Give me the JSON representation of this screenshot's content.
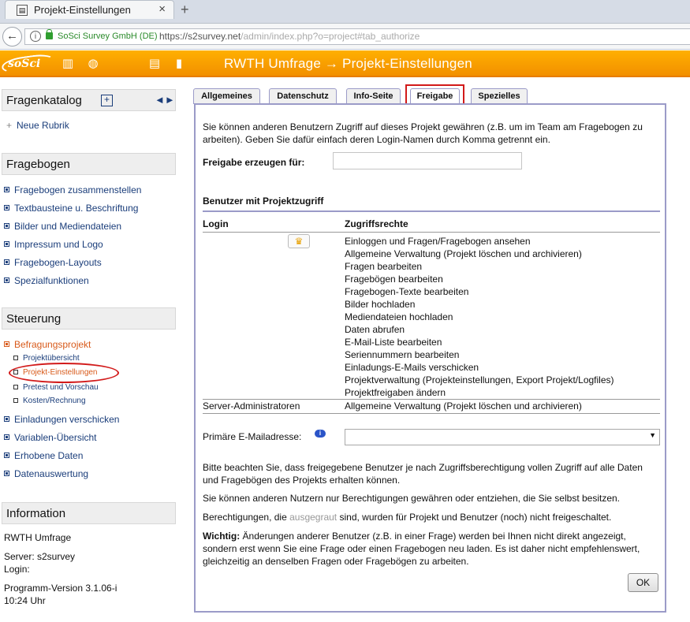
{
  "browser": {
    "tab_title": "Projekt-Einstellungen",
    "org": "SoSci Survey GmbH (DE)",
    "url_host": "https://s2survey.net",
    "url_path": "/admin/index.php?o=project#tab_authorize"
  },
  "header": {
    "logo": "soSci",
    "title": "RWTH Umfrage → Projekt-Einstellungen",
    "accent": "#f59a00"
  },
  "sidebar": {
    "fragenkatalog": {
      "title": "Fragenkatalog",
      "new_label": "Neue Rubrik"
    },
    "fragebogen": {
      "title": "Fragebogen",
      "items": [
        "Fragebogen zusammenstellen",
        "Textbausteine u. Beschriftung",
        "Bilder und Mediendateien",
        "Impressum und Logo",
        "Fragebogen-Layouts",
        "Spezialfunktionen"
      ]
    },
    "steuerung": {
      "title": "Steuerung",
      "active_item": "Befragungsprojekt",
      "subitems": [
        "Projektübersicht",
        "Projekt-Einstellungen",
        "Pretest und Vorschau",
        "Kosten/Rechnung"
      ],
      "items": [
        "Einladungen verschicken",
        "Variablen-Übersicht",
        "Erhobene Daten",
        "Datenauswertung"
      ]
    },
    "information": {
      "title": "Information",
      "project": "RWTH Umfrage",
      "server": "Server: s2survey",
      "login": "Login:",
      "version": "Programm-Version 3.1.06-i",
      "time": "10:24 Uhr"
    }
  },
  "tabs": [
    {
      "label": "Allgemeines",
      "selected": false
    },
    {
      "label": "Datenschutz",
      "selected": false
    },
    {
      "label": "Info-Seite",
      "selected": false
    },
    {
      "label": "Freigabe",
      "selected": true
    },
    {
      "label": "Spezielles",
      "selected": false
    }
  ],
  "panel": {
    "intro": "Sie können anderen Benutzern Zugriff auf dieses Projekt gewähren (z.B. um im Team am Fragebogen zu arbeiten). Geben Sie dafür einfach deren Login-Namen durch Komma getrennt ein.",
    "share_label": "Freigabe erzeugen für:",
    "share_value": "",
    "users_heading": "Benutzer mit Projektzugriff",
    "col_login": "Login",
    "col_rights": "Zugriffsrechte",
    "owner_rights": [
      "Einloggen und Fragen/Fragebogen ansehen",
      "Allgemeine Verwaltung (Projekt löschen und archivieren)",
      "Fragen bearbeiten",
      "Fragebögen bearbeiten",
      "Fragebogen-Texte bearbeiten",
      "Bilder hochladen",
      "Mediendateien hochladen",
      "Daten abrufen",
      "E-Mail-Liste bearbeiten",
      "Seriennummern bearbeiten",
      "Einladungs-E-Mails verschicken",
      "Projektverwaltung (Projekteinstellungen, Export Projekt/Logfiles)",
      "Projektfreigaben ändern"
    ],
    "admin_login": "Server-Administratoren",
    "admin_rights": "Allgemeine Verwaltung (Projekt löschen und archivieren)",
    "mail_label": "Primäre E-Mailadresse:",
    "mail_value": "",
    "note1": "Bitte beachten Sie, dass freigegebene Benutzer je nach Zugriffsberechtigung vollen Zugriff auf alle Daten und Fragebögen des Projekts erhalten können.",
    "note2": "Sie können anderen Nutzern nur Berechtigungen gewähren oder entziehen, die Sie selbst besitzen.",
    "note3_a": "Berechtigungen, die ",
    "note3_grey": "ausgegraut",
    "note3_b": " sind, wurden für Projekt und Benutzer (noch) nicht freigeschaltet.",
    "warn_bold": "Wichtig:",
    "warn_text": " Änderungen anderer Benutzer (z.B. in einer Frage) werden bei Ihnen nicht direkt angezeigt, sondern erst wenn Sie eine Frage oder einen Fragebogen neu laden. Es ist daher nicht empfehlenswert, gleichzeitig an denselben Fragen oder Fragebögen zu arbeiten.",
    "ok_label": "OK"
  }
}
